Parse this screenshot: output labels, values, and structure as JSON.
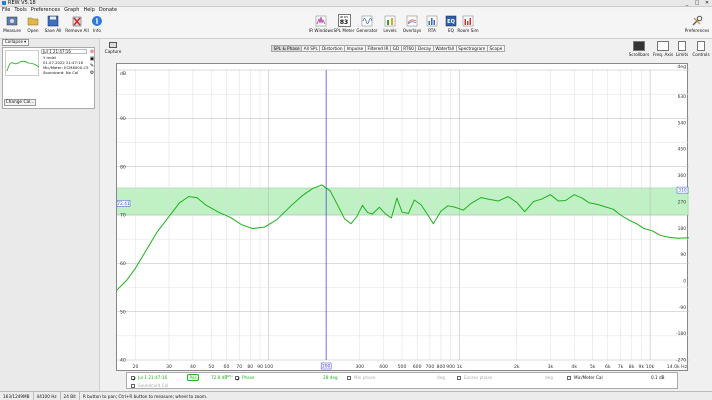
{
  "app": {
    "title": "REW V5.18"
  },
  "menu": [
    "File",
    "Tools",
    "Preferences",
    "Graph",
    "Help",
    "Donate"
  ],
  "toolbar": {
    "left": [
      {
        "label": "Measure",
        "icon": "microphone-icon"
      },
      {
        "label": "Open",
        "icon": "folder-open-icon"
      },
      {
        "label": "Save All",
        "icon": "save-icon"
      },
      {
        "label": "Remove All",
        "icon": "remove-all-icon"
      },
      {
        "label": "Info",
        "icon": "info-icon"
      }
    ],
    "center": [
      {
        "label": "IR Windows",
        "icon": "ir-windows-icon"
      },
      {
        "label": "SPL Meter",
        "icon": "spl-meter-icon",
        "meter_value": "83",
        "meter_unit": "dB SPL"
      },
      {
        "label": "Generator",
        "icon": "generator-icon"
      },
      {
        "label": "Levels",
        "icon": "levels-icon"
      },
      {
        "label": "Overlays",
        "icon": "overlays-icon"
      },
      {
        "label": "RTA",
        "icon": "rta-icon"
      },
      {
        "label": "EQ",
        "icon": "eq-icon"
      },
      {
        "label": "Room Sim",
        "icon": "room-sim-icon"
      }
    ],
    "right": [
      {
        "label": "Preferences",
        "icon": "preferences-icon"
      }
    ]
  },
  "left_panel": {
    "collapse_label": "Collapse",
    "measurement": {
      "name": "Jul 1 21:47:16",
      "info": [
        "Y mdel",
        "01.07.2022 21:47:16",
        "Mic/Meter: ECM8000-C5",
        "Soundcard: No Cal"
      ]
    },
    "change_cal_label": "Change Cal..."
  },
  "capture_label": "Capture",
  "tabs": [
    "SPL & Phase",
    "All SPL",
    "Distortion",
    "Impulse",
    "Filtered IR",
    "GD",
    "RT60",
    "Decay",
    "Waterfall",
    "Spectrogram",
    "Scope"
  ],
  "active_tab": "SPL & Phase",
  "right_controls": [
    "Scrollbars",
    "Freq. Axis",
    "Limits",
    "Controls"
  ],
  "chart": {
    "left_unit": "dB",
    "right_unit": "deg",
    "cursor_freq_label": "200",
    "left_marker_value": "72.41",
    "right_marker_value": "310",
    "x_end_label": "14.0k Hz"
  },
  "chart_data": {
    "type": "line",
    "xscale": "log",
    "xlim": [
      16,
      16000
    ],
    "ylim": [
      40,
      100
    ],
    "y2lim": [
      -270,
      720
    ],
    "xticks": [
      {
        "v": 20,
        "l": "20"
      },
      {
        "v": 30,
        "l": "30"
      },
      {
        "v": 40,
        "l": "40"
      },
      {
        "v": 50,
        "l": "50"
      },
      {
        "v": 60,
        "l": "60"
      },
      {
        "v": 70,
        "l": "70"
      },
      {
        "v": 80,
        "l": "80"
      },
      {
        "v": 90,
        "l": "90"
      },
      {
        "v": 100,
        "l": "100"
      },
      {
        "v": 200,
        "l": "200"
      },
      {
        "v": 300,
        "l": "300"
      },
      {
        "v": 400,
        "l": "400"
      },
      {
        "v": 500,
        "l": "500"
      },
      {
        "v": 600,
        "l": "600"
      },
      {
        "v": 700,
        "l": "700"
      },
      {
        "v": 800,
        "l": "800"
      },
      {
        "v": 900,
        "l": "900"
      },
      {
        "v": 1000,
        "l": "1k"
      },
      {
        "v": 2000,
        "l": "2k"
      },
      {
        "v": 3000,
        "l": "3k"
      },
      {
        "v": 4000,
        "l": "4k"
      },
      {
        "v": 5000,
        "l": "5k"
      },
      {
        "v": 6000,
        "l": "6k"
      },
      {
        "v": 7000,
        "l": "7k"
      },
      {
        "v": 8000,
        "l": "8k"
      },
      {
        "v": 9000,
        "l": "9k"
      },
      {
        "v": 10000,
        "l": "10k"
      }
    ],
    "yticks": [
      40,
      50,
      60,
      70,
      80,
      90
    ],
    "y2ticks": [
      -270,
      -180,
      -90,
      0,
      90,
      180,
      270,
      360,
      450,
      540,
      630
    ],
    "cursor_x": 200,
    "band": {
      "low": 70,
      "high": 75.6
    },
    "series": [
      {
        "name": "Jul 1 21:47:16",
        "color": "#1db21d",
        "x": [
          16,
          18,
          20,
          23,
          26,
          30,
          34,
          38,
          42,
          47,
          55,
          63,
          72,
          82,
          95,
          110,
          130,
          150,
          170,
          190,
          210,
          230,
          250,
          270,
          290,
          310,
          330,
          350,
          380,
          410,
          440,
          470,
          500,
          540,
          580,
          630,
          680,
          730,
          800,
          870,
          950,
          1050,
          1150,
          1300,
          1450,
          1600,
          1800,
          2000,
          2200,
          2450,
          2700,
          3000,
          3300,
          3600,
          4000,
          4400,
          4800,
          5300,
          5800,
          6400,
          7000,
          7700,
          8500,
          9300,
          10300,
          11300,
          12500,
          14000,
          16000
        ],
        "y": [
          54.5,
          56.5,
          59,
          63,
          66.5,
          69.7,
          72.5,
          73.8,
          73.6,
          72,
          70.5,
          69.5,
          68,
          67.2,
          67.5,
          69,
          71.8,
          74,
          75.5,
          76.2,
          75,
          72,
          69.2,
          68.2,
          69.7,
          72,
          70.5,
          70.2,
          71.6,
          70.2,
          69.4,
          73.5,
          70.6,
          70.3,
          73.1,
          72.1,
          70.1,
          68.2,
          70.8,
          71.9,
          71.6,
          71,
          72.4,
          73.6,
          73.2,
          72.9,
          73.8,
          72.6,
          70.7,
          72.8,
          73.3,
          74.2,
          72.9,
          73,
          74.2,
          73.5,
          72.5,
          72.2,
          71.7,
          71.2,
          70,
          69,
          68.2,
          67.2,
          66.7,
          65.8,
          65.4,
          65.2,
          65.3
        ]
      }
    ]
  },
  "legend": [
    {
      "label": "Jul 1 21:47:16",
      "color": "#1db21d",
      "checked": true,
      "badge": "Pos",
      "value": "72.8 dB",
      "unit_suffix": "(SPL)"
    },
    {
      "label": "Phase",
      "color": "#1db21d",
      "checked": true,
      "value": "28 deg"
    },
    {
      "label": "Min phase",
      "color": "#bbbbbb",
      "checked": false,
      "value": "deg"
    },
    {
      "label": "Excess phase",
      "color": "#bbbbbb",
      "checked": false,
      "value": "deg"
    },
    {
      "label": "Mic/Meter Cal",
      "color": "#000000",
      "checked": false,
      "value": "0.1 dB"
    },
    {
      "label": "Soundcard Cal",
      "color": "#bbbbbb",
      "checked": false,
      "value": ""
    }
  ],
  "status": [
    "163/1249MB",
    "44100 Hz",
    "24 Bit",
    "R button to pan; Ctrl+R button to measure; wheel to zoom."
  ]
}
